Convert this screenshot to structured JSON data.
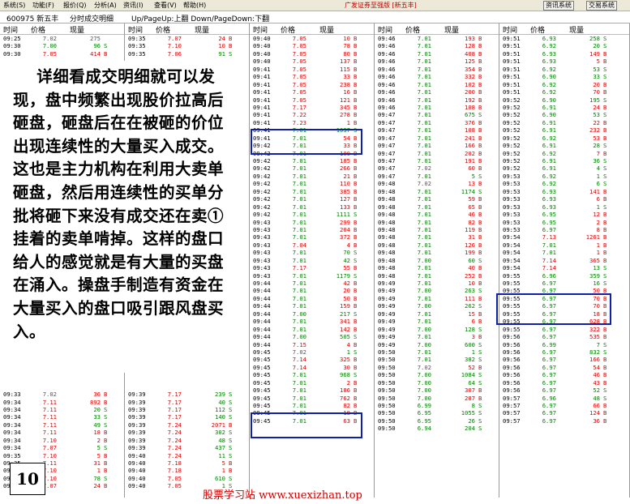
{
  "menu": [
    "系统(S)",
    "功能(F)",
    "报价(Q)",
    "分析(A)",
    "资讯(I)",
    "查看(V)",
    "帮助(H)"
  ],
  "app_title": "广发证券至强版 [新五丰]",
  "top_buttons": [
    "资讯系统",
    "交易系统"
  ],
  "stock": {
    "code_name": "600975 新五丰",
    "view": "分时成交明细",
    "hint": "Up/PageUp:上翻 Down/PageDown:下翻"
  },
  "columns_header": {
    "time": "时间",
    "price": "价格",
    "volume": "现量"
  },
  "columns": [
    {
      "top": [
        [
          "09:25",
          "7.02",
          "275",
          ""
        ],
        [
          "09:30",
          "7.00",
          "96",
          "S"
        ],
        [
          "09:30",
          "7.05",
          "414",
          "B"
        ]
      ],
      "bottom": [
        [
          "09:33",
          "7.02",
          "36",
          "B"
        ],
        [
          "09:34",
          "7.11",
          "892",
          "B"
        ],
        [
          "09:34",
          "7.11",
          "20",
          "S"
        ],
        [
          "09:34",
          "7.11",
          "33",
          "S"
        ],
        [
          "09:34",
          "7.11",
          "49",
          "S"
        ],
        [
          "09:34",
          "7.11",
          "18",
          "B"
        ],
        [
          "09:34",
          "7.10",
          "2",
          "B"
        ],
        [
          "09:34",
          "7.07",
          "5",
          "S"
        ],
        [
          "09:35",
          "7.10",
          "5",
          "B"
        ],
        [
          "09:35",
          "7.11",
          "31",
          "B"
        ],
        [
          "09:35",
          "7.10",
          "1",
          "B"
        ],
        [
          "09:35",
          "7.10",
          "78",
          "S"
        ],
        [
          "09:35",
          "7.07",
          "24",
          "B"
        ]
      ]
    },
    {
      "top": [
        [
          "09:35",
          "7.07",
          "24",
          "B"
        ],
        [
          "09:35",
          "7.10",
          "10",
          "B"
        ],
        [
          "09:35",
          "7.06",
          "91",
          "S"
        ]
      ],
      "bottom": [
        [
          "09:39",
          "7.17",
          "239",
          "S"
        ],
        [
          "09:39",
          "7.17",
          "40",
          "S"
        ],
        [
          "09:39",
          "7.17",
          "112",
          "S"
        ],
        [
          "09:39",
          "7.17",
          "140",
          "S"
        ],
        [
          "09:39",
          "7.24",
          "2071",
          "B"
        ],
        [
          "09:39",
          "7.24",
          "302",
          "S"
        ],
        [
          "09:39",
          "7.24",
          "48",
          "S"
        ],
        [
          "09:39",
          "7.24",
          "437",
          "S"
        ],
        [
          "09:40",
          "7.24",
          "11",
          "S"
        ],
        [
          "09:40",
          "7.18",
          "5",
          "B"
        ],
        [
          "09:40",
          "7.18",
          "1",
          "B"
        ],
        [
          "09:40",
          "7.05",
          "610",
          "S"
        ],
        [
          "09:40",
          "7.05",
          "1",
          "S"
        ]
      ]
    },
    {
      "rows": [
        [
          "09:40",
          "7.05",
          "10",
          "B"
        ],
        [
          "09:40",
          "7.05",
          "78",
          "B"
        ],
        [
          "09:40",
          "7.05",
          "80",
          "B"
        ],
        [
          "09:40",
          "7.05",
          "137",
          "B"
        ],
        [
          "09:41",
          "7.05",
          "115",
          "B"
        ],
        [
          "09:41",
          "7.05",
          "33",
          "B"
        ],
        [
          "09:41",
          "7.05",
          "238",
          "B"
        ],
        [
          "09:41",
          "7.05",
          "16",
          "B"
        ],
        [
          "09:41",
          "7.05",
          "121",
          "B"
        ],
        [
          "09:41",
          "7.17",
          "345",
          "B"
        ],
        [
          "09:41",
          "7.22",
          "278",
          "B"
        ],
        [
          "09:41",
          "7.23",
          "1",
          "B"
        ],
        [
          "09:41",
          "7.01",
          "1037",
          "S"
        ],
        [
          "09:41",
          "7.01",
          "54",
          "B"
        ],
        [
          "09:42",
          "7.01",
          "33",
          "B"
        ],
        [
          "09:42",
          "7.01",
          "100",
          "B"
        ],
        [
          "09:42",
          "7.01",
          "185",
          "B"
        ],
        [
          "09:42",
          "7.01",
          "266",
          "B"
        ],
        [
          "09:42",
          "7.01",
          "21",
          "B"
        ],
        [
          "09:42",
          "7.01",
          "110",
          "B"
        ],
        [
          "09:42",
          "7.01",
          "385",
          "B"
        ],
        [
          "09:42",
          "7.01",
          "127",
          "B"
        ],
        [
          "09:42",
          "7.01",
          "133",
          "B"
        ],
        [
          "09:42",
          "7.01",
          "1111",
          "S"
        ],
        [
          "09:43",
          "7.01",
          "299",
          "B"
        ],
        [
          "09:43",
          "7.01",
          "204",
          "B"
        ],
        [
          "09:43",
          "7.01",
          "372",
          "B"
        ],
        [
          "09:43",
          "7.04",
          "4",
          "B"
        ],
        [
          "09:43",
          "7.01",
          "70",
          "S"
        ],
        [
          "09:43",
          "7.01",
          "42",
          "S"
        ],
        [
          "09:43",
          "7.17",
          "55",
          "B"
        ],
        [
          "09:43",
          "7.01",
          "1179",
          "S"
        ],
        [
          "09:44",
          "7.01",
          "42",
          "B"
        ],
        [
          "09:44",
          "7.01",
          "20",
          "B"
        ],
        [
          "09:44",
          "7.01",
          "50",
          "B"
        ],
        [
          "09:44",
          "7.01",
          "159",
          "B"
        ],
        [
          "09:44",
          "7.00",
          "217",
          "S"
        ],
        [
          "09:44",
          "7.01",
          "341",
          "B"
        ],
        [
          "09:44",
          "7.01",
          "142",
          "B"
        ],
        [
          "09:44",
          "7.00",
          "505",
          "S"
        ],
        [
          "09:44",
          "7.15",
          "4",
          "B"
        ],
        [
          "09:45",
          "7.02",
          "1",
          "S"
        ],
        [
          "09:45",
          "7.14",
          "325",
          "B"
        ],
        [
          "09:45",
          "7.14",
          "30",
          "B"
        ],
        [
          "09:45",
          "7.01",
          "968",
          "S"
        ],
        [
          "09:45",
          "7.01",
          "2",
          "B"
        ],
        [
          "09:45",
          "7.01",
          "186",
          "B"
        ],
        [
          "09:45",
          "7.01",
          "762",
          "B"
        ],
        [
          "09:45",
          "7.01",
          "82",
          "B"
        ],
        [
          "09:45",
          "7.01",
          "18",
          "B"
        ],
        [
          "09:45",
          "7.01",
          "63",
          "B"
        ]
      ]
    },
    {
      "rows": [
        [
          "09:46",
          "7.01",
          "193",
          "B"
        ],
        [
          "09:46",
          "7.01",
          "128",
          "B"
        ],
        [
          "09:46",
          "7.01",
          "408",
          "B"
        ],
        [
          "09:46",
          "7.01",
          "125",
          "B"
        ],
        [
          "09:46",
          "7.01",
          "354",
          "B"
        ],
        [
          "09:46",
          "7.01",
          "332",
          "B"
        ],
        [
          "09:46",
          "7.01",
          "102",
          "B"
        ],
        [
          "09:46",
          "7.01",
          "200",
          "B"
        ],
        [
          "09:46",
          "7.01",
          "192",
          "B"
        ],
        [
          "09:46",
          "7.01",
          "108",
          "B"
        ],
        [
          "09:47",
          "7.01",
          "675",
          "S"
        ],
        [
          "09:47",
          "7.01",
          "376",
          "B"
        ],
        [
          "09:47",
          "7.01",
          "108",
          "B"
        ],
        [
          "09:47",
          "7.01",
          "241",
          "B"
        ],
        [
          "09:47",
          "7.01",
          "166",
          "B"
        ],
        [
          "09:47",
          "7.01",
          "202",
          "B"
        ],
        [
          "09:47",
          "7.01",
          "191",
          "B"
        ],
        [
          "09:47",
          "7.02",
          "60",
          "B"
        ],
        [
          "09:47",
          "7.01",
          "5",
          "S"
        ],
        [
          "09:48",
          "7.02",
          "13",
          "B"
        ],
        [
          "09:48",
          "7.01",
          "1174",
          "S"
        ],
        [
          "09:48",
          "7.01",
          "59",
          "B"
        ],
        [
          "09:48",
          "7.01",
          "65",
          "B"
        ],
        [
          "09:48",
          "7.01",
          "46",
          "B"
        ],
        [
          "09:48",
          "7.01",
          "82",
          "B"
        ],
        [
          "09:48",
          "7.01",
          "119",
          "B"
        ],
        [
          "09:48",
          "7.01",
          "31",
          "B"
        ],
        [
          "09:48",
          "7.01",
          "126",
          "B"
        ],
        [
          "09:48",
          "7.01",
          "199",
          "B"
        ],
        [
          "09:48",
          "7.00",
          "60",
          "S"
        ],
        [
          "09:48",
          "7.01",
          "40",
          "B"
        ],
        [
          "09:48",
          "7.01",
          "252",
          "B"
        ],
        [
          "09:49",
          "7.01",
          "10",
          "B"
        ],
        [
          "09:49",
          "7.00",
          "263",
          "S"
        ],
        [
          "09:49",
          "7.01",
          "111",
          "B"
        ],
        [
          "09:49",
          "7.00",
          "262",
          "S"
        ],
        [
          "09:49",
          "7.01",
          "15",
          "B"
        ],
        [
          "09:49",
          "7.01",
          "6",
          "B"
        ],
        [
          "09:49",
          "7.00",
          "128",
          "S"
        ],
        [
          "09:49",
          "7.01",
          "3",
          "B"
        ],
        [
          "09:49",
          "7.00",
          "600",
          "S"
        ],
        [
          "09:50",
          "7.01",
          "1",
          "S"
        ],
        [
          "09:50",
          "7.01",
          "382",
          "S"
        ],
        [
          "09:50",
          "7.02",
          "52",
          "B"
        ],
        [
          "09:50",
          "7.00",
          "1084",
          "S"
        ],
        [
          "09:50",
          "7.00",
          "64",
          "S"
        ],
        [
          "09:50",
          "7.00",
          "307",
          "B"
        ],
        [
          "09:50",
          "7.00",
          "287",
          "B"
        ],
        [
          "09:50",
          "6.99",
          "8",
          "S"
        ],
        [
          "09:50",
          "6.95",
          "1055",
          "S"
        ],
        [
          "09:50",
          "6.95",
          "26",
          "S"
        ],
        [
          "09:50",
          "6.94",
          "204",
          "S"
        ]
      ]
    },
    {
      "rows": [
        [
          "09:51",
          "6.93",
          "258",
          "S"
        ],
        [
          "09:51",
          "6.92",
          "20",
          "S"
        ],
        [
          "09:51",
          "6.93",
          "149",
          "B"
        ],
        [
          "09:51",
          "6.93",
          "5",
          "B"
        ],
        [
          "09:51",
          "6.92",
          "53",
          "S"
        ],
        [
          "09:51",
          "6.90",
          "33",
          "S"
        ],
        [
          "09:51",
          "6.92",
          "20",
          "B"
        ],
        [
          "09:51",
          "6.92",
          "70",
          "B"
        ],
        [
          "09:52",
          "6.90",
          "195",
          "S"
        ],
        [
          "09:52",
          "6.91",
          "24",
          "B"
        ],
        [
          "09:52",
          "6.90",
          "53",
          "S"
        ],
        [
          "09:52",
          "6.91",
          "22",
          "B"
        ],
        [
          "09:52",
          "6.91",
          "232",
          "B"
        ],
        [
          "09:52",
          "6.92",
          "53",
          "B"
        ],
        [
          "09:52",
          "6.91",
          "28",
          "S"
        ],
        [
          "09:52",
          "6.92",
          "7",
          "B"
        ],
        [
          "09:52",
          "6.91",
          "36",
          "S"
        ],
        [
          "09:52",
          "6.91",
          "4",
          "S"
        ],
        [
          "09:53",
          "6.92",
          "1",
          "S"
        ],
        [
          "09:53",
          "6.92",
          "6",
          "S"
        ],
        [
          "09:53",
          "6.93",
          "141",
          "B"
        ],
        [
          "09:53",
          "6.93",
          "6",
          "B"
        ],
        [
          "09:53",
          "6.93",
          "1",
          "S"
        ],
        [
          "09:53",
          "6.95",
          "12",
          "B"
        ],
        [
          "09:53",
          "6.95",
          "2",
          "B"
        ],
        [
          "09:53",
          "6.97",
          "8",
          "B"
        ],
        [
          "09:54",
          "7.13",
          "1261",
          "B"
        ],
        [
          "09:54",
          "7.01",
          "1",
          "B"
        ],
        [
          "09:54",
          "7.01",
          "1",
          "B"
        ],
        [
          "09:54",
          "7.14",
          "365",
          "B"
        ],
        [
          "09:54",
          "7.14",
          "13",
          "S"
        ],
        [
          "09:55",
          "6.96",
          "359",
          "S"
        ],
        [
          "09:55",
          "6.97",
          "16",
          "S"
        ],
        [
          "09:55",
          "6.97",
          "50",
          "B"
        ],
        [
          "09:55",
          "6.97",
          "70",
          "B"
        ],
        [
          "09:55",
          "6.97",
          "70",
          "B"
        ],
        [
          "09:55",
          "6.97",
          "18",
          "B"
        ],
        [
          "09:55",
          "6.97",
          "628",
          "B"
        ],
        [
          "09:55",
          "6.97",
          "322",
          "B"
        ],
        [
          "09:56",
          "6.97",
          "535",
          "B"
        ],
        [
          "09:56",
          "6.99",
          "7",
          "S"
        ],
        [
          "09:56",
          "6.97",
          "832",
          "S"
        ],
        [
          "09:56",
          "6.97",
          "166",
          "B"
        ],
        [
          "09:56",
          "6.97",
          "54",
          "B"
        ],
        [
          "09:56",
          "6.97",
          "46",
          "B"
        ],
        [
          "09:56",
          "6.97",
          "43",
          "B"
        ],
        [
          "09:56",
          "6.97",
          "52",
          "S"
        ],
        [
          "09:57",
          "6.96",
          "48",
          "S"
        ],
        [
          "09:57",
          "6.97",
          "66",
          "B"
        ],
        [
          "09:57",
          "6.97",
          "124",
          "B"
        ],
        [
          "09:57",
          "6.97",
          "36",
          "B"
        ]
      ]
    }
  ],
  "annotation": "详细看成交明细就可以发现，盘中频繁出现股价拉高后砸盘，砸盘后在在被砸的价位出现连续性的大量买入成交。 这也是主力机构在利用大卖单砸盘，然后用连续性的买单分批将砸下来没有成交还在卖①挂着的卖单啃掉。这样的盘口给人的感觉就是有大量的买盘在涌入。操盘手制造有资金在大量买入的盘口吸引跟风盘买入。",
  "page_number": "10",
  "watermark": "股票学习站  www.xuexizhan.top",
  "colors": {
    "up": "#e00000",
    "down": "#008000",
    "highlight_box": "#1020a8",
    "watermark": "#d00000"
  },
  "reference_close": 7.02
}
